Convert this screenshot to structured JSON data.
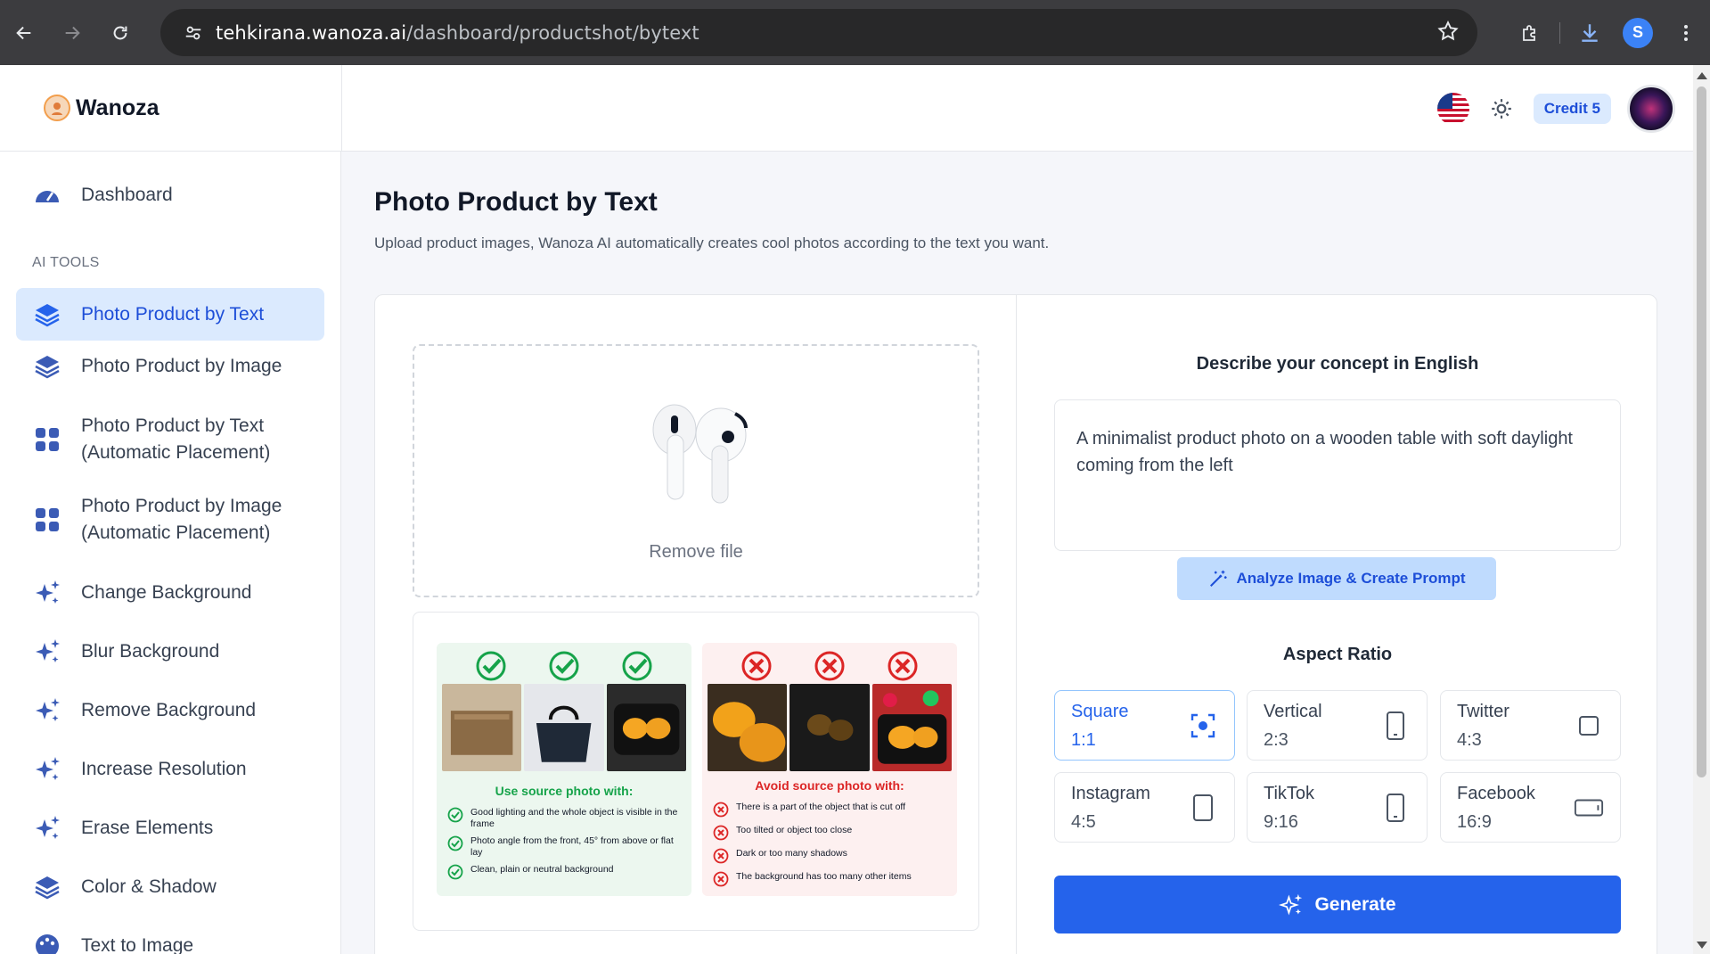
{
  "browser": {
    "url_host": "tehkirana.wanoza.ai",
    "url_path": "/dashboard/productshot/bytext"
  },
  "header": {
    "brand": "Wanoza",
    "credit_label": "Credit 5",
    "language_icon": "us-flag-icon",
    "theme_icon": "sun-icon"
  },
  "sidebar": {
    "dashboard": "Dashboard",
    "section_label": "AI TOOLS",
    "items": [
      {
        "label": "Photo Product by Text",
        "icon": "layers-icon",
        "active": true
      },
      {
        "label": "Photo Product by Image",
        "icon": "layers-icon"
      },
      {
        "label": "Photo Product by Text (Automatic Placement)",
        "icon": "grid-icon"
      },
      {
        "label": "Photo Product by Image (Automatic Placement)",
        "icon": "grid-icon"
      },
      {
        "label": "Change Background",
        "icon": "sparkles-icon"
      },
      {
        "label": "Blur Background",
        "icon": "sparkles-icon"
      },
      {
        "label": "Remove Background",
        "icon": "sparkles-icon"
      },
      {
        "label": "Increase Resolution",
        "icon": "sparkles-icon"
      },
      {
        "label": "Erase Elements",
        "icon": "sparkles-icon"
      },
      {
        "label": "Color & Shadow",
        "icon": "layers-icon"
      },
      {
        "label": "Text to Image",
        "icon": "palette-icon"
      }
    ]
  },
  "main": {
    "title": "Photo Product by Text",
    "subtitle": "Upload product images, Wanoza AI automatically creates cool photos according to the text you want.",
    "upload": {
      "remove_label": "Remove file"
    },
    "guide": {
      "good_title": "Use source photo with:",
      "good_items": [
        "Good lighting and the whole object is visible in the frame",
        "Photo angle from the front, 45° from above or flat lay",
        "Clean, plain or neutral background"
      ],
      "bad_title": "Avoid source photo with:",
      "bad_items": [
        "There is a part of the object that is cut off",
        "Too tilted or object too close",
        "Dark or too many shadows",
        "The background has too many other items"
      ]
    },
    "concept": {
      "title": "Describe your concept in English",
      "prompt": "A minimalist product photo on a wooden table with soft daylight coming from the left",
      "analyze_label": "Analyze Image & Create Prompt"
    },
    "aspect": {
      "title": "Aspect Ratio",
      "options": [
        {
          "name": "Square",
          "ratio": "1:1",
          "active": true
        },
        {
          "name": "Vertical",
          "ratio": "2:3"
        },
        {
          "name": "Twitter",
          "ratio": "4:3"
        },
        {
          "name": "Instagram",
          "ratio": "4:5"
        },
        {
          "name": "TikTok",
          "ratio": "9:16"
        },
        {
          "name": "Facebook",
          "ratio": "16:9"
        }
      ]
    },
    "generate_label": "Generate"
  }
}
